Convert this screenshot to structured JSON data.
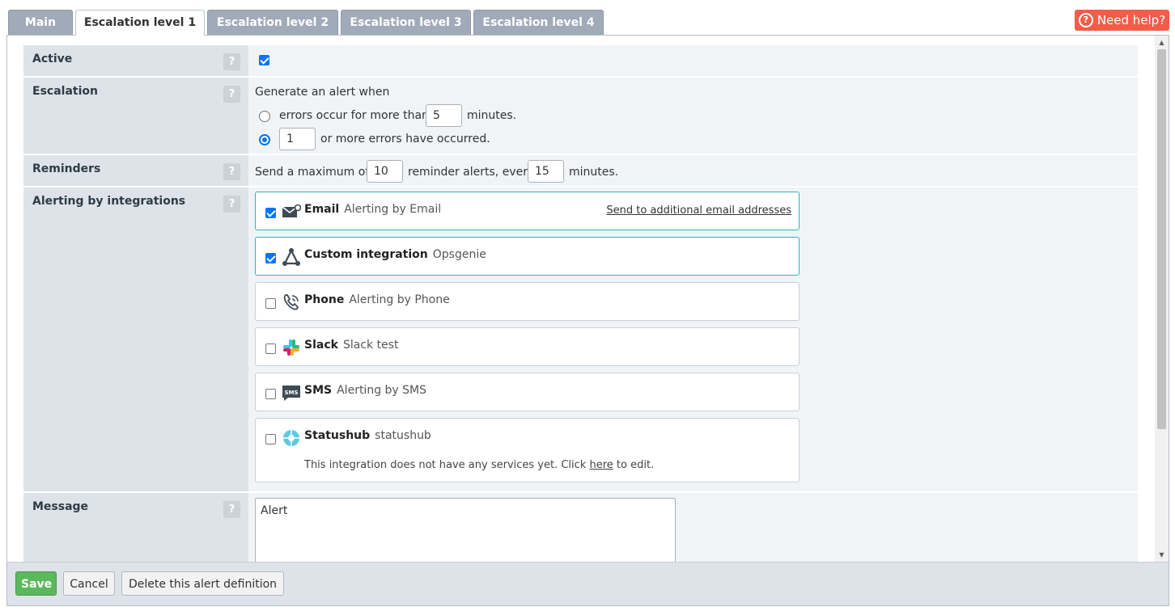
{
  "tabs": [
    "Main",
    "Escalation level 1",
    "Escalation level 2",
    "Escalation level 3",
    "Escalation level 4"
  ],
  "active_tab": "Escalation level 1",
  "help_button": "Need help?",
  "help_mark": "?",
  "qmark": "?",
  "form": {
    "active": {
      "label": "Active",
      "checked": true
    },
    "escalation": {
      "label": "Escalation",
      "intro": "Generate an alert when",
      "option1_prefix": "errors occur for more than",
      "option1_value": "5",
      "option1_suffix": "minutes.",
      "option2_value": "1",
      "option2_suffix": "or more errors have occurred.",
      "selected_option": 2
    },
    "reminders": {
      "label": "Reminders",
      "prefix": "Send a maximum of",
      "count": "10",
      "middle": "reminder alerts, every",
      "interval": "15",
      "suffix": "minutes."
    },
    "integrations": {
      "label": "Alerting by integrations",
      "items": [
        {
          "name": "Email",
          "desc": "Alerting by Email",
          "checked": true,
          "icon": "email-icon",
          "link": "Send to additional email addresses"
        },
        {
          "name": "Custom integration",
          "desc": "Opsgenie",
          "checked": true,
          "icon": "custom-integration-icon"
        },
        {
          "name": "Phone",
          "desc": "Alerting by Phone",
          "checked": false,
          "icon": "phone-icon"
        },
        {
          "name": "Slack",
          "desc": "Slack test",
          "checked": false,
          "icon": "slack-icon"
        },
        {
          "name": "SMS",
          "desc": "Alerting by SMS",
          "checked": false,
          "icon": "sms-icon"
        },
        {
          "name": "Statushub",
          "desc": "statushub",
          "checked": false,
          "icon": "statushub-icon",
          "note_prefix": "This integration does not have any services yet. Click",
          "note_link": "here",
          "note_suffix": "to edit."
        }
      ]
    },
    "message": {
      "label": "Message",
      "value": "Alert"
    }
  },
  "footer": {
    "save": "Save",
    "cancel": "Cancel",
    "delete": "Delete this alert definition"
  },
  "colors": {
    "help": "#f25c4a",
    "save": "#5cb85c",
    "accent": "#2bb5b8",
    "label_bg": "#dde3e8",
    "value_bg": "#f0f4f7"
  }
}
